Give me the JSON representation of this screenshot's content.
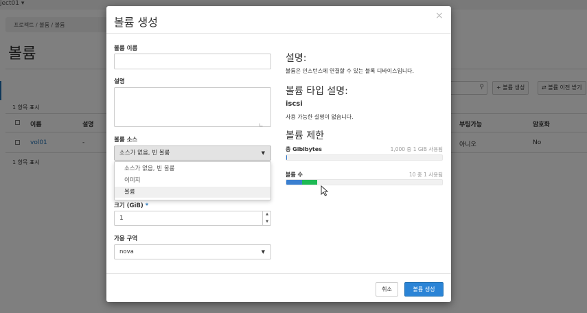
{
  "background": {
    "project_text": "ject01 ▾",
    "breadcrumb": "프로젝트 / 볼륨 / 볼륨",
    "page_title": "볼륨",
    "filter_icon": "search-icon",
    "create_button": "+ 볼륨 생성",
    "transfer_button": "⇄ 볼륨 이전 받기",
    "count_top": "1 항목 표시",
    "count_bottom": "1 항목 표시",
    "columns": [
      "이름",
      "설명",
      "부팅가능",
      "암호화"
    ],
    "row": {
      "name": "vol01",
      "description": "-",
      "bootable": "아니오",
      "encrypted": "No"
    }
  },
  "modal": {
    "title": "볼륨 생성",
    "close_glyph": "×",
    "form": {
      "name_label": "볼륨 이름",
      "name_value": "",
      "description_label": "설명",
      "description_value": "",
      "source_label": "볼륨 소스",
      "source_selected": "소스가 없음, 빈 볼륨",
      "source_options": [
        "소스가 없음, 빈 볼륨",
        "이미지",
        "볼륨"
      ],
      "size_label": "크기 (GiB)",
      "size_required": "*",
      "size_value": "1",
      "az_label": "가용 구역",
      "az_value": "nova"
    },
    "help": {
      "desc_heading": "설명:",
      "desc_text": "볼륨은 인스턴스에 연결할 수 있는 블록 디바이스입니다.",
      "type_heading": "볼륨 타입 설명:",
      "type_name": "iscsi",
      "type_desc": "사용 가능한 설명이 없습니다.",
      "limits_heading": "볼륨 제한",
      "quota_gb_label": "총 Gibibytes",
      "quota_gb_usage": "1,000 중 1 GiB 사용됨",
      "quota_gb_fraction": 0.001,
      "quota_vol_label": "볼륨 수",
      "quota_vol_usage": "10 중 1 사용됨",
      "quota_vol_used_fraction": 0.1,
      "quota_vol_added_fraction": 0.1
    },
    "footer": {
      "cancel_label": "취소",
      "submit_label": "볼륨 생성"
    }
  },
  "colors": {
    "primary": "#2b84d6",
    "quota_used": "#3a7fd0",
    "quota_new": "#1db954",
    "overlay": "rgba(0,0,0,0.5)"
  }
}
